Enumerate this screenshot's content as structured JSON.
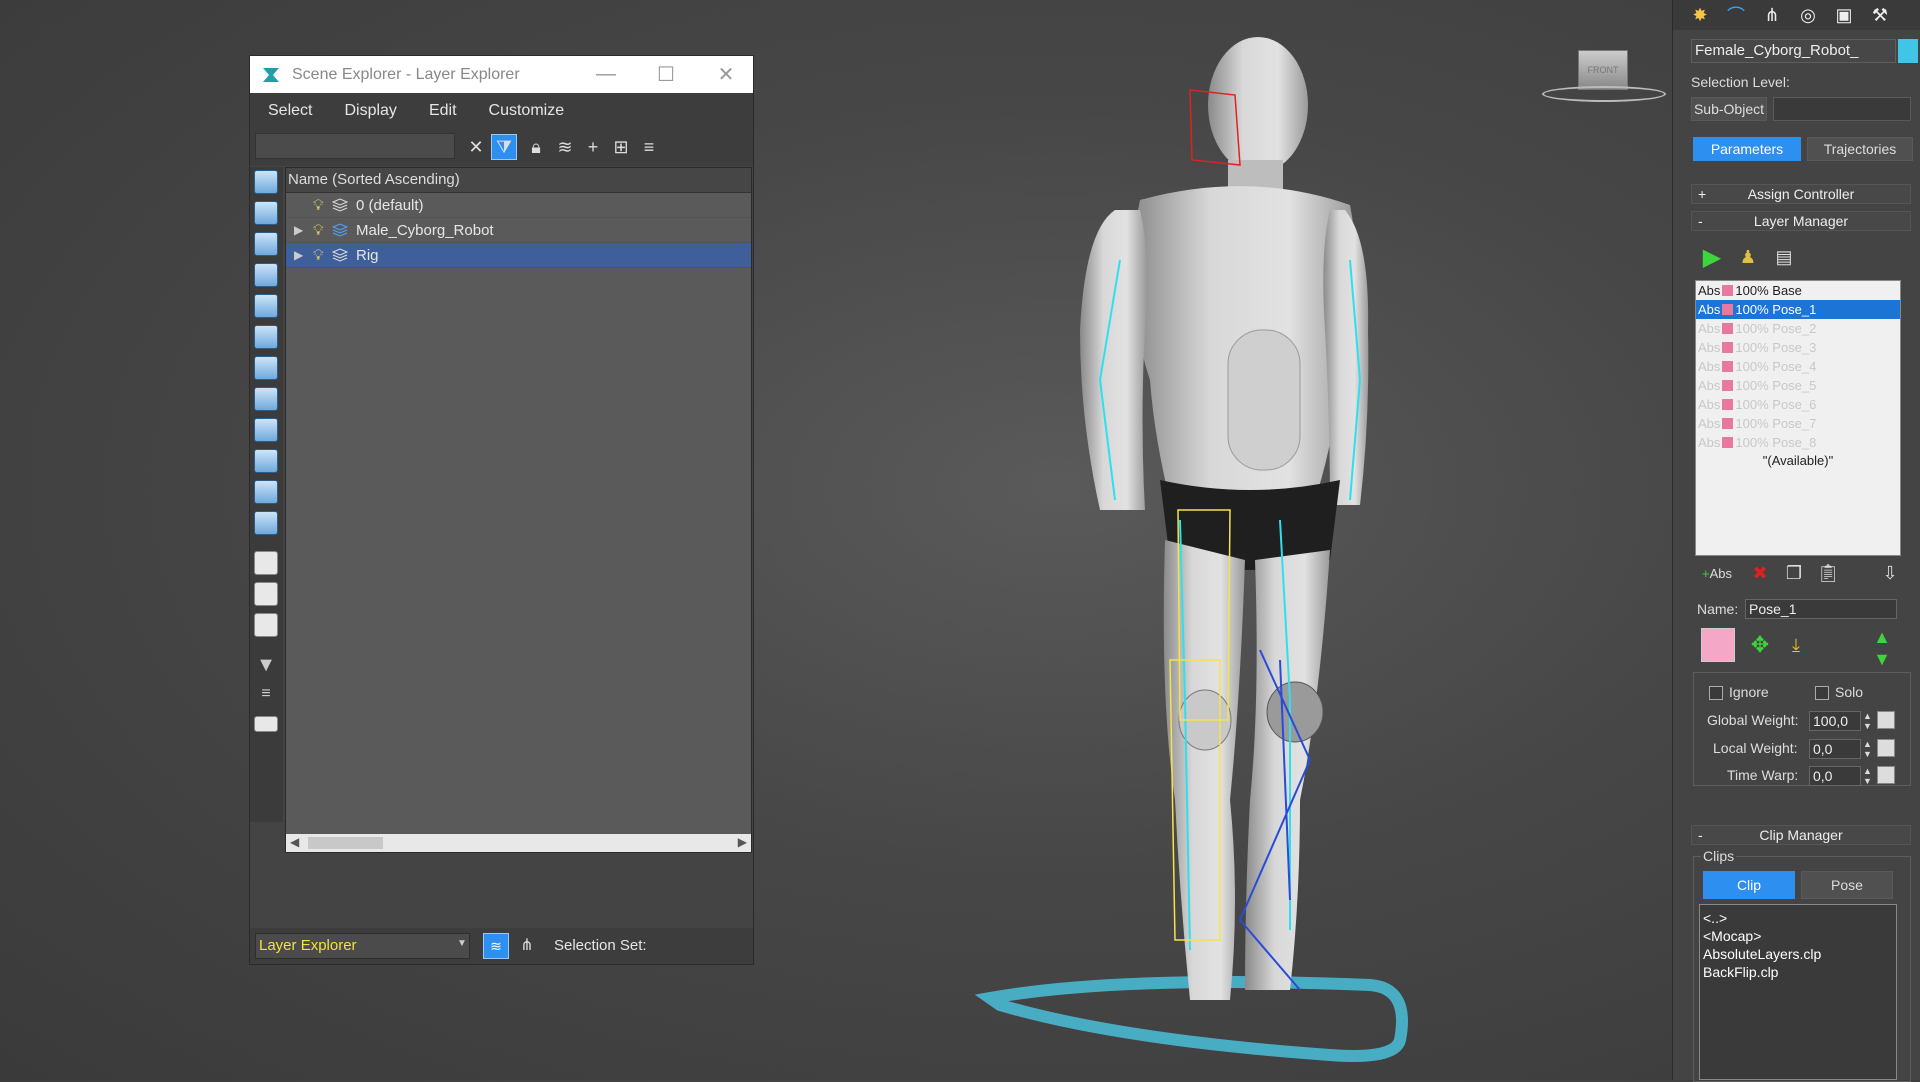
{
  "scene_explorer": {
    "title": "Scene Explorer - Layer Explorer",
    "menu": [
      "Select",
      "Display",
      "Edit",
      "Customize"
    ],
    "column_header": "Name (Sorted Ascending)",
    "rows": [
      {
        "label": "0 (default)",
        "expandable": false,
        "selected": false
      },
      {
        "label": "Male_Cyborg_Robot",
        "expandable": true,
        "selected": false
      },
      {
        "label": "Rig",
        "expandable": true,
        "selected": true
      }
    ],
    "explorer_select": "Layer Explorer",
    "selection_set_label": "Selection Set:"
  },
  "viewport": {
    "viewcube_label": "FRONT"
  },
  "command_panel": {
    "object_name": "Female_Cyborg_Robot_",
    "object_color": "#3fc6e6",
    "selection_level_label": "Selection Level:",
    "sub_object_button": "Sub-Object",
    "tabs": [
      "Parameters",
      "Trajectories"
    ],
    "assign_controller": "Assign Controller",
    "layer_manager": "Layer Manager",
    "layers": [
      {
        "prefix": "Abs",
        "pct": "100%",
        "name": "Base",
        "state": "normal"
      },
      {
        "prefix": "Abs",
        "pct": "100%",
        "name": "Pose_1",
        "state": "selected"
      },
      {
        "prefix": "Abs",
        "pct": "100%",
        "name": "Pose_2",
        "state": "dim"
      },
      {
        "prefix": "Abs",
        "pct": "100%",
        "name": "Pose_3",
        "state": "dim"
      },
      {
        "prefix": "Abs",
        "pct": "100%",
        "name": "Pose_4",
        "state": "dim"
      },
      {
        "prefix": "Abs",
        "pct": "100%",
        "name": "Pose_5",
        "state": "dim"
      },
      {
        "prefix": "Abs",
        "pct": "100%",
        "name": "Pose_6",
        "state": "dim"
      },
      {
        "prefix": "Abs",
        "pct": "100%",
        "name": "Pose_7",
        "state": "dim"
      },
      {
        "prefix": "Abs",
        "pct": "100%",
        "name": "Pose_8",
        "state": "dim"
      }
    ],
    "available_text": "\"(Available)\"",
    "add_abs_label": "Abs",
    "name_label": "Name:",
    "name_value": "Pose_1",
    "layer_color": "#f4a7c6",
    "ignore_label": "Ignore",
    "solo_label": "Solo",
    "global_weight_label": "Global Weight:",
    "global_weight_value": "100,0",
    "local_weight_label": "Local Weight:",
    "local_weight_value": "0,0",
    "time_warp_label": "Time Warp:",
    "time_warp_value": "0,0",
    "clip_manager": "Clip Manager",
    "clips_group": "Clips",
    "clip_tabs": [
      "Clip",
      "Pose"
    ],
    "clips": [
      "<..>",
      "<Mocap>",
      "AbsoluteLayers.clp",
      "BackFlip.clp"
    ]
  }
}
